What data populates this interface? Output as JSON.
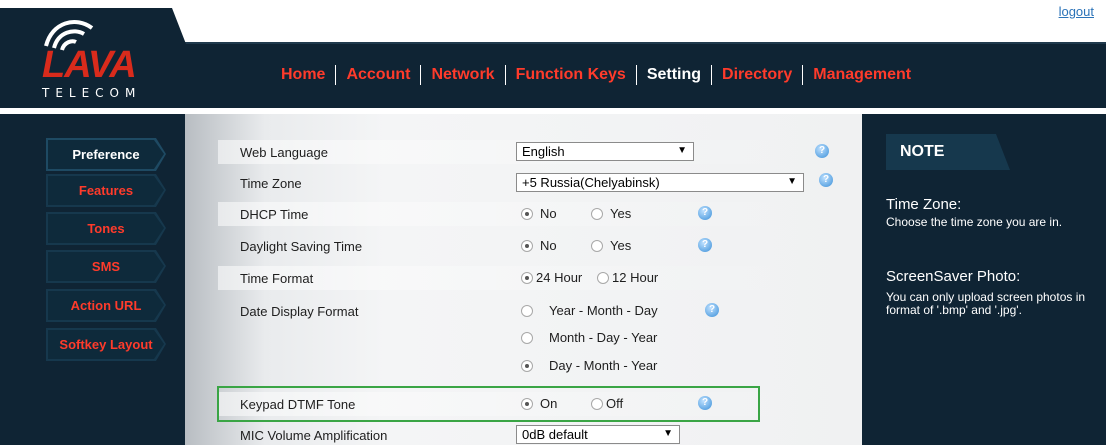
{
  "header": {
    "logout": "logout",
    "logo": {
      "brand": "LAVA",
      "sub": "TELECOM"
    },
    "nav": [
      {
        "label": "Home",
        "active": false
      },
      {
        "label": "Account",
        "active": false
      },
      {
        "label": "Network",
        "active": false
      },
      {
        "label": "Function Keys",
        "active": false
      },
      {
        "label": "Setting",
        "active": true
      },
      {
        "label": "Directory",
        "active": false
      },
      {
        "label": "Management",
        "active": false
      }
    ]
  },
  "sidebar": {
    "items": [
      {
        "label": "Preference",
        "active": true
      },
      {
        "label": "Features",
        "active": false
      },
      {
        "label": "Tones",
        "active": false
      },
      {
        "label": "SMS",
        "active": false
      },
      {
        "label": "Action URL",
        "active": false
      },
      {
        "label": "Softkey Layout",
        "active": false
      }
    ]
  },
  "settings": {
    "web_language": {
      "label": "Web Language",
      "value": "English"
    },
    "time_zone": {
      "label": "Time Zone",
      "value": "+5 Russia(Chelyabinsk)"
    },
    "dhcp_time": {
      "label": "DHCP Time",
      "options": [
        "No",
        "Yes"
      ],
      "selected": "No"
    },
    "daylight_saving": {
      "label": "Daylight Saving Time",
      "options": [
        "No",
        "Yes"
      ],
      "selected": "No"
    },
    "time_format": {
      "label": "Time Format",
      "options": [
        "24 Hour",
        "12 Hour"
      ],
      "selected": "24 Hour"
    },
    "date_display_format": {
      "label": "Date Display Format",
      "options": [
        "Year - Month - Day",
        "Month - Day - Year",
        "Day - Month - Year"
      ],
      "selected": "Day - Month - Year"
    },
    "keypad_dtmf": {
      "label": "Keypad DTMF Tone",
      "options": [
        "On",
        "Off"
      ],
      "selected": "On"
    },
    "mic_volume": {
      "label": "MIC Volume Amplification",
      "value": "0dB default"
    }
  },
  "note": {
    "tab": "NOTE",
    "sections": [
      {
        "title": "Time Zone:",
        "text": "Choose the time zone you are in."
      },
      {
        "title": "ScreenSaver Photo:",
        "text": "You can only upload screen photos in format of '.bmp' and '.jpg'."
      }
    ]
  },
  "help_glyph": "?",
  "colors": {
    "accent_red": "#ff3b2b",
    "dark_navy": "#0f2434",
    "highlight_green": "#3aa545",
    "link_blue": "#2b73b8"
  }
}
